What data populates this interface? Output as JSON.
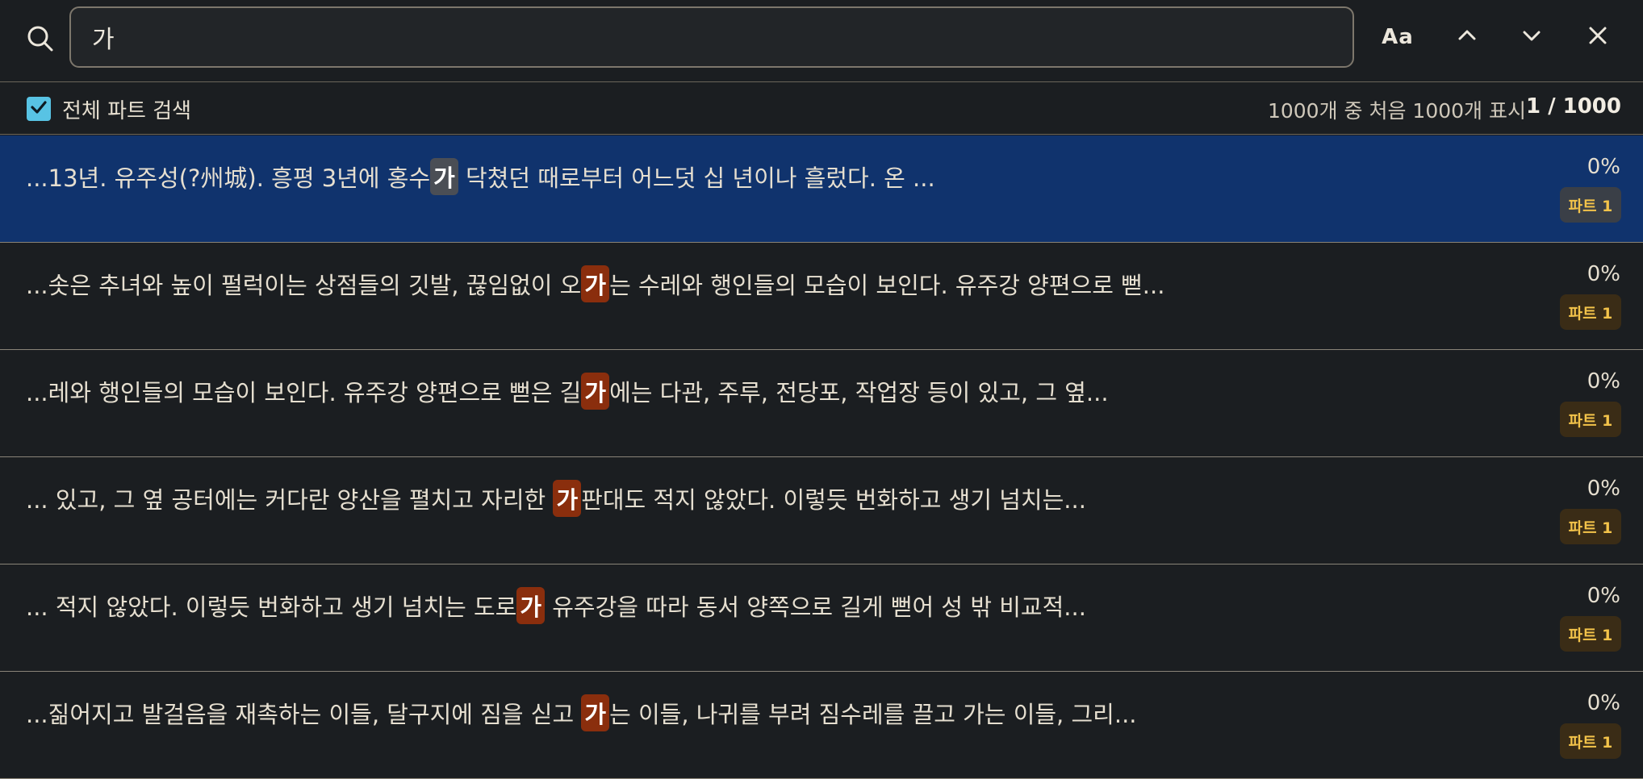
{
  "search": {
    "query": "가",
    "case_label": "Aa"
  },
  "options": {
    "search_all_parts_label": "전체 파트 검색",
    "search_all_parts_checked": true,
    "result_count_text": "1000개 중 처음 1000개 표시",
    "position_text": "1 / 1000"
  },
  "results": [
    {
      "before": "...13년. 유주성(?州城). 흥평 3년에 홍수",
      "match": "가",
      "after": " 닥쳤던 때로부터 어느덧 십 년이나 흘렀다. 온 ...",
      "percent": "0%",
      "part": "파트 1",
      "active": true
    },
    {
      "before": "...솟은 추녀와 높이 펄럭이는 상점들의 깃발, 끊임없이 오",
      "match": "가",
      "after": "는 수레와 행인들의 모습이 보인다. 유주강 양편으로 뻗...",
      "percent": "0%",
      "part": "파트 1",
      "active": false
    },
    {
      "before": "...레와 행인들의 모습이 보인다. 유주강 양편으로 뻗은 길",
      "match": "가",
      "after": "에는 다관, 주루, 전당포, 작업장 등이 있고, 그 옆...",
      "percent": "0%",
      "part": "파트 1",
      "active": false
    },
    {
      "before": "... 있고, 그 옆 공터에는 커다란 양산을 펼치고 자리한 ",
      "match": "가",
      "after": "판대도 적지 않았다. 이렇듯 번화하고 생기 넘치는...",
      "percent": "0%",
      "part": "파트 1",
      "active": false
    },
    {
      "before": "... 적지 않았다. 이렇듯 번화하고 생기 넘치는 도로",
      "match": "가",
      "after": " 유주강을 따라 동서 양쪽으로 길게 뻗어 성 밖 비교적...",
      "percent": "0%",
      "part": "파트 1",
      "active": false
    },
    {
      "before": "...짊어지고 발걸음을 재촉하는 이들, 달구지에 짐을 싣고 ",
      "match": "가",
      "after": "는 이들, 나귀를 부려 짐수레를 끌고 가는 이들, 그리...",
      "percent": "0%",
      "part": "파트 1",
      "active": false
    }
  ],
  "colors": {
    "background": "#1b1e21",
    "active_row": "#10336d",
    "highlight": "#8a2e0d",
    "checkbox": "#58c3e4",
    "badge_text": "#f3c34a"
  }
}
